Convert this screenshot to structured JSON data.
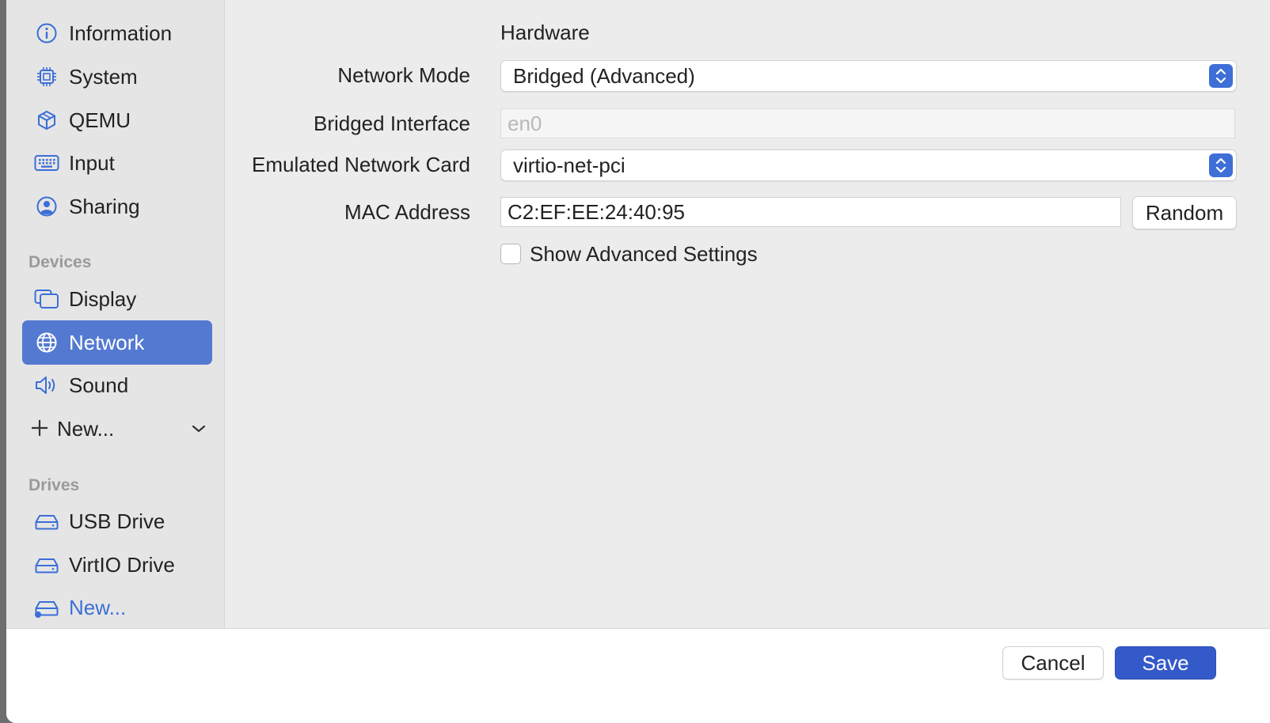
{
  "sidebar": {
    "items": [
      {
        "label": "Information",
        "icon": "info-circle-icon"
      },
      {
        "label": "System",
        "icon": "cpu-chip-icon"
      },
      {
        "label": "QEMU",
        "icon": "cube-icon"
      },
      {
        "label": "Input",
        "icon": "keyboard-icon"
      },
      {
        "label": "Sharing",
        "icon": "person-circle-icon"
      }
    ],
    "devices_header": "Devices",
    "devices": [
      {
        "label": "Display",
        "icon": "display-windows-icon"
      },
      {
        "label": "Network",
        "icon": "globe-icon",
        "selected": true
      },
      {
        "label": "Sound",
        "icon": "speaker-icon"
      }
    ],
    "new_device_label": "New...",
    "drives_header": "Drives",
    "drives": [
      {
        "label": "USB Drive",
        "icon": "drive-icon"
      },
      {
        "label": "VirtIO Drive",
        "icon": "drive-icon"
      },
      {
        "label": "New...",
        "icon": "drive-add-icon"
      }
    ]
  },
  "form": {
    "section_title": "Hardware",
    "network_mode": {
      "label": "Network Mode",
      "value": "Bridged (Advanced)"
    },
    "bridged_interface": {
      "label": "Bridged Interface",
      "placeholder": "en0"
    },
    "network_card": {
      "label": "Emulated Network Card",
      "value": "virtio-net-pci"
    },
    "mac_address": {
      "label": "MAC Address",
      "value": "C2:EF:EE:24:40:95",
      "random_label": "Random"
    },
    "advanced": {
      "label": "Show Advanced Settings",
      "checked": false
    }
  },
  "footer": {
    "cancel_label": "Cancel",
    "save_label": "Save"
  },
  "colors": {
    "accent": "#3459c9",
    "selection": "#5479d1",
    "icon_blue": "#3a6fd6"
  }
}
